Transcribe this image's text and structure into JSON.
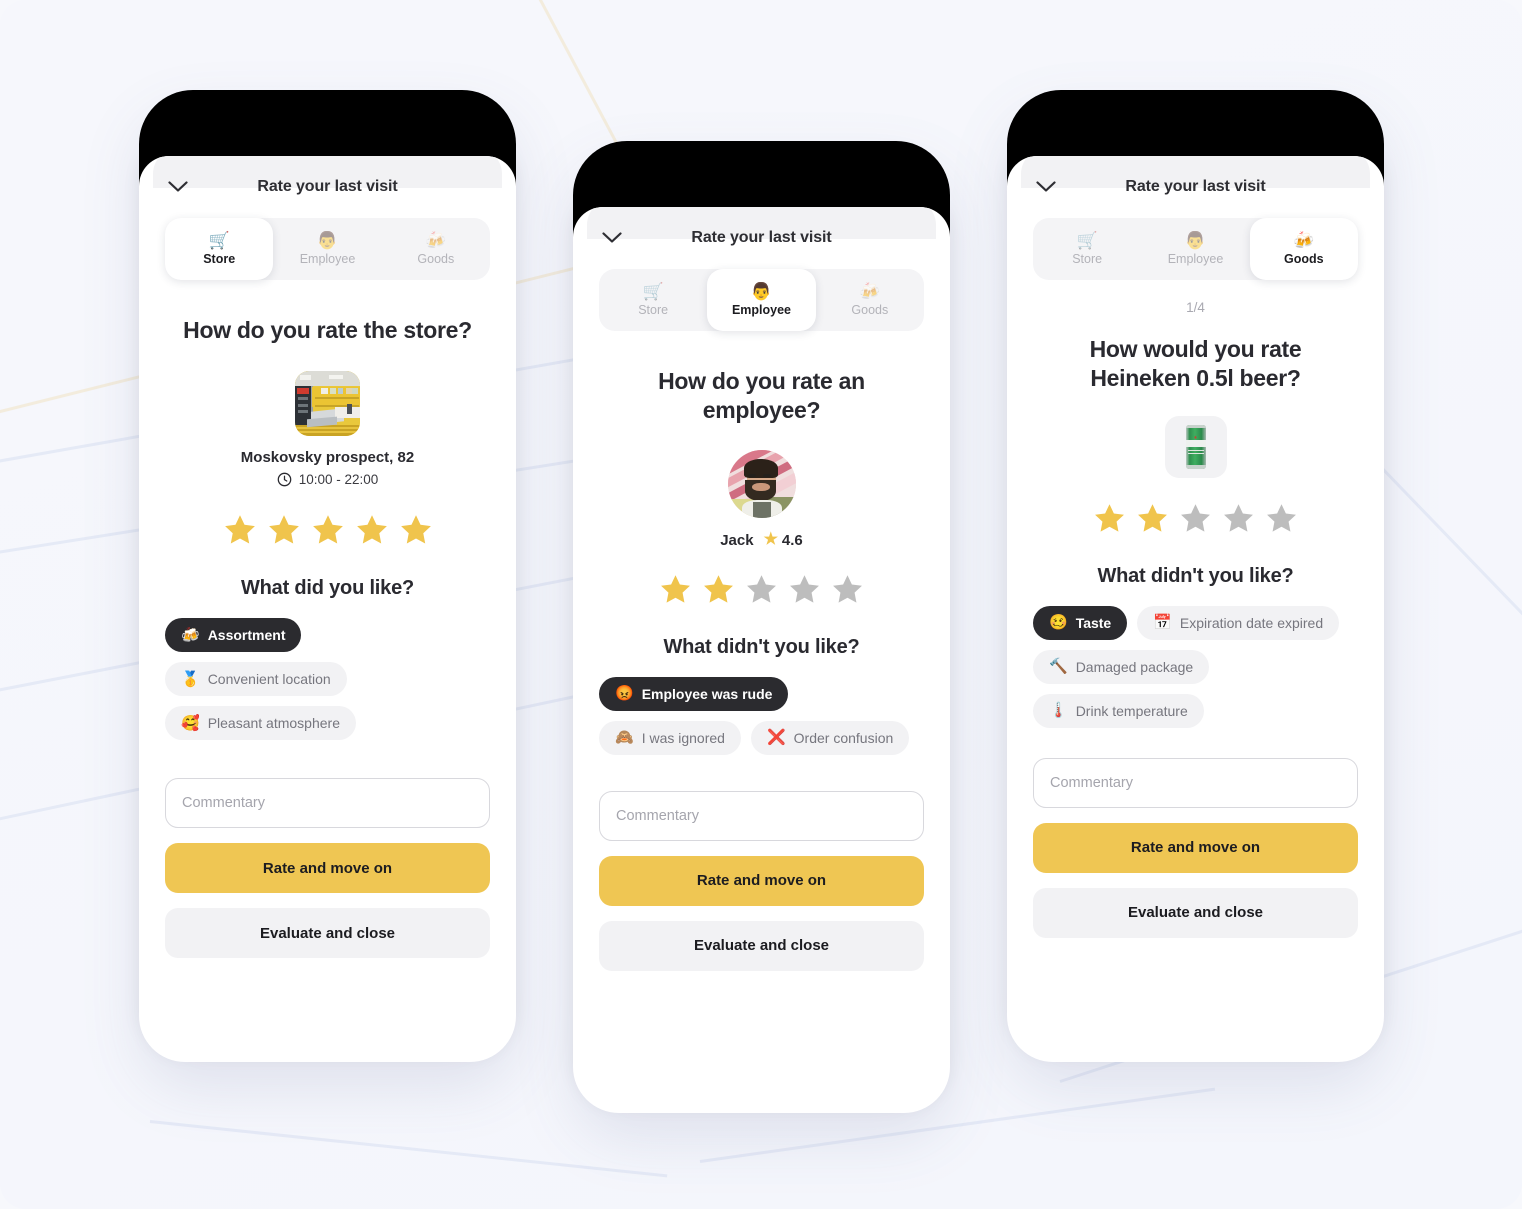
{
  "app": {
    "sheet_title": "Rate your last visit",
    "chevron_icon": "chevron-down-icon"
  },
  "tabs": [
    {
      "id": "store",
      "label": "Store",
      "emoji": "🛒",
      "icon": "shopping-cart-icon"
    },
    {
      "id": "employee",
      "label": "Employee",
      "emoji": "👨",
      "icon": "person-icon"
    },
    {
      "id": "goods",
      "label": "Goods",
      "emoji": "🍻",
      "icon": "beer-mugs-icon"
    }
  ],
  "common": {
    "commentary_placeholder": "Commentary",
    "primary_button": "Rate and move on",
    "secondary_button": "Evaluate and close"
  },
  "colors": {
    "accent_yellow": "#EFC653",
    "star_filled": "#F0C44C",
    "star_empty": "#BDBDBD",
    "chip_selected_bg": "#2B2B2F",
    "chip_bg": "#F2F2F4",
    "background": "#F6F7FC",
    "text_primary": "#2A2A30",
    "text_muted": "#A9A9B1"
  },
  "screens": [
    {
      "id": "store-screen",
      "active_tab": "store",
      "question": "How do you rate the store?",
      "place_name": "Moskovsky prospect, 82",
      "hours": "10:00 - 22:00",
      "clock_icon": "clock-icon",
      "rating": 5,
      "rating_max": 5,
      "sub_question": "What did you like?",
      "chips": [
        {
          "label": "Assortment",
          "emoji": "🍻",
          "icon": "beer-mugs-icon",
          "selected": true
        },
        {
          "label": "Convenient location",
          "emoji": "🥇",
          "icon": "medal-icon",
          "selected": false
        },
        {
          "label": "Pleasant atmosphere",
          "emoji": "🥰",
          "icon": "smiling-face-hearts-icon",
          "selected": false
        }
      ]
    },
    {
      "id": "employee-screen",
      "active_tab": "employee",
      "question": "How do you rate an employee?",
      "person_name": "Jack",
      "person_rating": "4.6",
      "rating": 2,
      "rating_max": 5,
      "sub_question": "What didn't you like?",
      "chips": [
        {
          "label": "Employee was rude",
          "emoji": "😡",
          "icon": "angry-face-icon",
          "selected": true
        },
        {
          "label": "I was ignored",
          "emoji": "🙈",
          "icon": "see-no-evil-monkey-icon",
          "selected": false
        },
        {
          "label": "Order confusion",
          "emoji": "❌",
          "icon": "cross-mark-icon",
          "selected": false
        }
      ]
    },
    {
      "id": "goods-screen",
      "active_tab": "goods",
      "step": "1/4",
      "question": "How would you rate Heineken 0.5l beer?",
      "product_icon": "beer-can-icon",
      "rating": 2,
      "rating_max": 5,
      "sub_question": "What didn't you like?",
      "chips": [
        {
          "label": "Taste",
          "emoji": "🥴",
          "icon": "woozy-face-icon",
          "selected": true
        },
        {
          "label": "Expiration date expired",
          "emoji": "📅",
          "icon": "calendar-icon",
          "selected": false
        },
        {
          "label": "Damaged package",
          "emoji": "🔨",
          "icon": "hammer-icon",
          "selected": false
        },
        {
          "label": "Drink temperature",
          "emoji": "🌡️",
          "icon": "thermometer-icon",
          "selected": false
        }
      ]
    }
  ]
}
